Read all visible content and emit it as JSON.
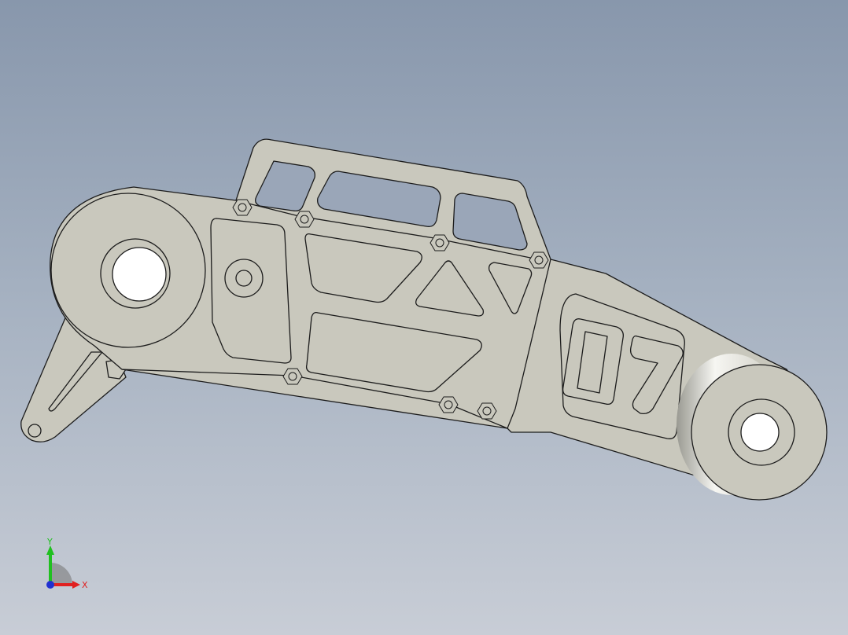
{
  "part": {
    "engraving_text": "07",
    "face_color": "#c9c8bd",
    "edge_color": "#1c1c1c"
  },
  "triad": {
    "x_label": "X",
    "y_label": "Y",
    "x_color": "#e02020",
    "y_color": "#20c020",
    "origin_color": "#2030d0"
  },
  "viewport": {
    "background_top": "#8897ac",
    "background_bottom": "#c8cdd6"
  }
}
